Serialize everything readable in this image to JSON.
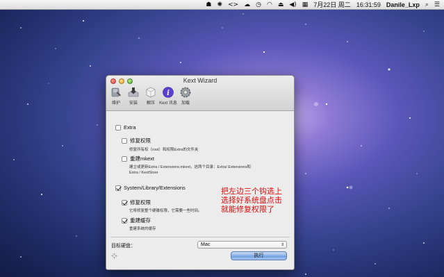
{
  "menubar": {
    "status_icons": [
      "user-icon",
      "gear-icon",
      "code-icon",
      "cloud-icon",
      "history-icon",
      "wifi-icon",
      "eject-icon",
      "volume-icon",
      "input-menu-icon"
    ],
    "date": "7月22日 周二",
    "time": "16:31:59",
    "user": "Danile_Lxp",
    "search_glyph": "⌕",
    "menu_glyph": "☰"
  },
  "window": {
    "title": "Kext Wizard",
    "toolbar": [
      {
        "name": "maintain",
        "label": "维护",
        "icon": "wrench-icon"
      },
      {
        "name": "install",
        "label": "安装",
        "icon": "download-icon"
      },
      {
        "name": "unpack",
        "label": "解压",
        "icon": "package-icon"
      },
      {
        "name": "kextinfo",
        "label": "Kext 讯息",
        "icon": "info-icon"
      },
      {
        "name": "load",
        "label": "加载",
        "icon": "gear-icon"
      }
    ],
    "extra": {
      "label": "Extra",
      "checked": false,
      "repair_perms": {
        "label": "修复权限",
        "checked": false,
        "desc": "修复所有权（root）和权限Extra的文件夹"
      },
      "rebuild_mkext": {
        "label": "重建mkext",
        "checked": false,
        "desc1": "建立或更新Extra / Extensions.mkext，这两个目录：Extra/ Extensions和",
        "desc2": "Extra / KextStore"
      }
    },
    "sle": {
      "label": "System/Library/Extensions",
      "checked": true,
      "repair_perms": {
        "label": "修复权限",
        "checked": true,
        "desc": "它将修复整个硬碟权限，它需要一些时间。"
      },
      "rebuild_cache": {
        "label": "重建缓存",
        "checked": true,
        "desc": "重建系统的缓存"
      }
    },
    "target_label": "目标硬盘：",
    "target_value": "Mac",
    "run_label": "执行"
  },
  "annotation": {
    "text": "把左边三个钩选上\n选择好系统盘点击\n就能修复权限了",
    "color": "#e10d0d"
  }
}
